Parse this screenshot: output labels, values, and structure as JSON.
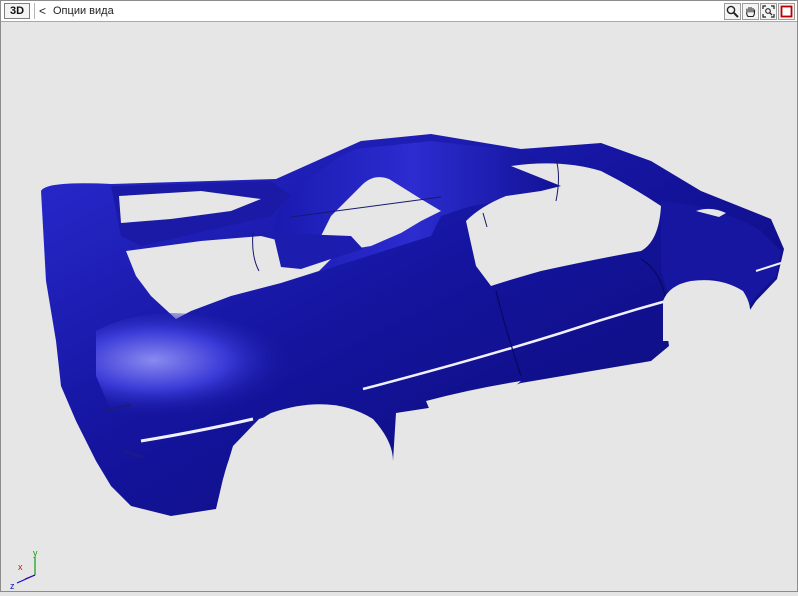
{
  "toolbar": {
    "mode_label": "3D",
    "back_label": "<",
    "view_options_label": "Опции вида",
    "tools": [
      {
        "name": "zoom",
        "icon": "magnifier-icon"
      },
      {
        "name": "pan",
        "icon": "hand-icon"
      },
      {
        "name": "fit",
        "icon": "zoom-extents-icon"
      },
      {
        "name": "maximize",
        "icon": "maximize-icon"
      }
    ]
  },
  "axis_triad": {
    "x_label": "x",
    "y_label": "y",
    "z_label": "z",
    "x_color": "#d01010",
    "y_color": "#10a010",
    "z_color": "#1010c0"
  },
  "model": {
    "icon": "car-body-model",
    "color": "#10108c"
  }
}
